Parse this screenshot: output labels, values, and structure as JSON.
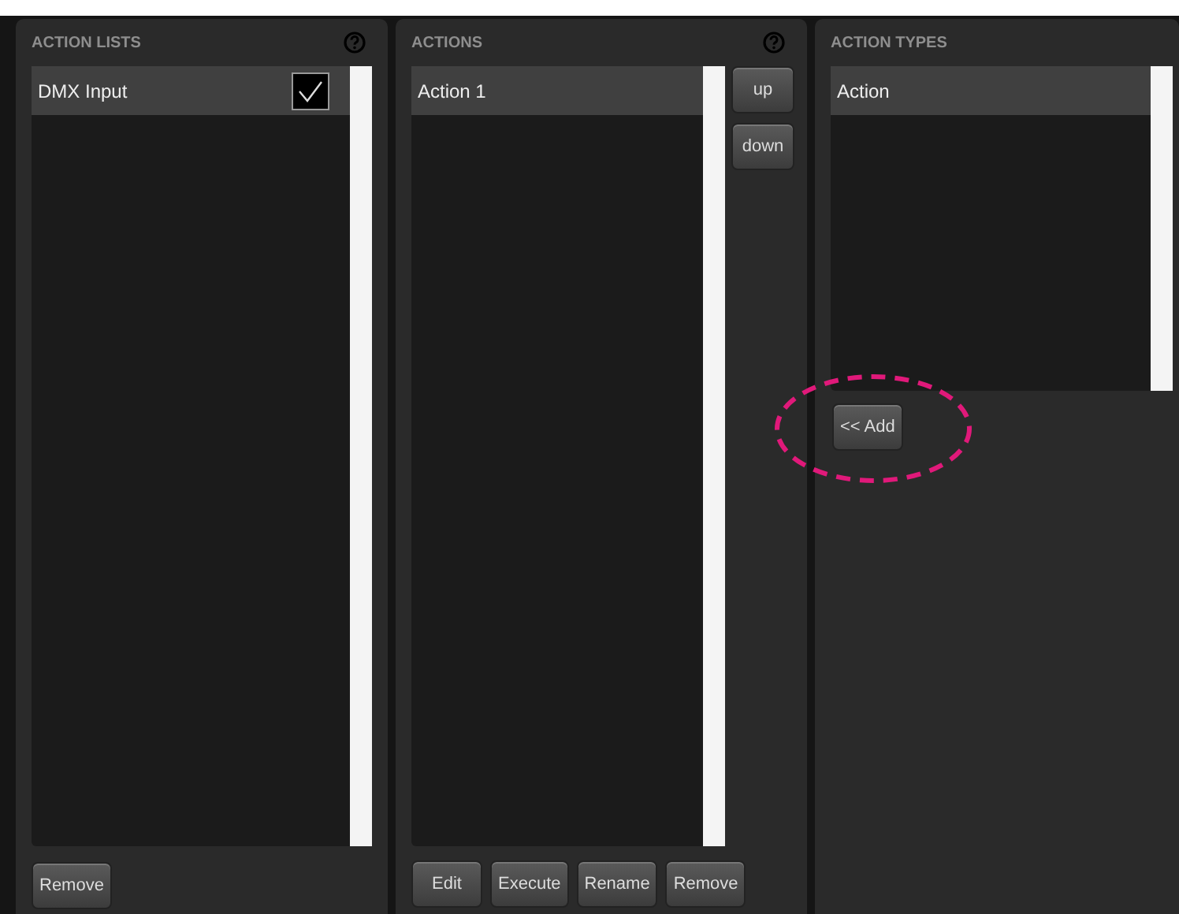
{
  "panels": [
    {
      "title": "ACTION LISTS",
      "help": true,
      "items": [
        {
          "label": "DMX Input",
          "selected": true,
          "checked": true
        }
      ],
      "bottom_buttons": [
        "Remove"
      ]
    },
    {
      "title": "ACTIONS",
      "help": true,
      "items": [
        {
          "label": "Action 1",
          "selected": true
        }
      ],
      "side_buttons": [
        "up",
        "down"
      ],
      "bottom_buttons": [
        "Edit",
        "Execute",
        "Rename",
        "Remove"
      ]
    },
    {
      "title": "ACTION TYPES",
      "items": [
        {
          "label": "Action",
          "selected": true
        }
      ],
      "add_button": {
        "label": "<< Add",
        "highlighted": true
      }
    }
  ]
}
